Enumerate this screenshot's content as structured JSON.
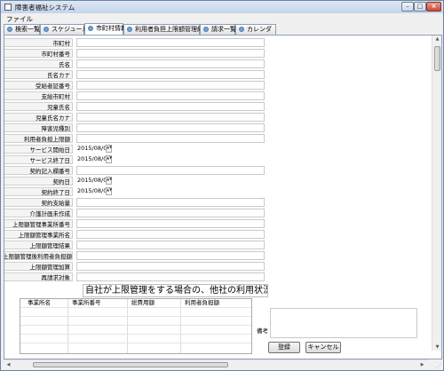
{
  "window": {
    "title": "障害者福祉システム"
  },
  "menu": {
    "file": "ファイル"
  },
  "tabs": [
    {
      "label": "検索一覧"
    },
    {
      "label": "スケジュール"
    },
    {
      "label": "市町村情報"
    },
    {
      "label": "利用者負担上限額管理結果票"
    },
    {
      "label": "請求一覧"
    },
    {
      "label": "カレンダ"
    }
  ],
  "active_tab": "市町村情報",
  "form": {
    "fields": [
      {
        "label": "市町村"
      },
      {
        "label": "市町村番号"
      },
      {
        "label": "氏名"
      },
      {
        "label": "氏名カナ"
      },
      {
        "label": "受給者証番号"
      },
      {
        "label": "支給市町村"
      },
      {
        "label": "児童氏名"
      },
      {
        "label": "児童氏名カナ"
      },
      {
        "label": "障害児種別"
      },
      {
        "label": "利用者負担上限額"
      },
      {
        "label": "サービス開始日",
        "value": "2015/08/08"
      },
      {
        "label": "サービス終了日",
        "value": "2015/08/08"
      },
      {
        "label": "契約記入欄番号"
      },
      {
        "label": "契約日",
        "value": "2015/08/08"
      },
      {
        "label": "契約終了日",
        "value": "2015/08/08"
      },
      {
        "label": "契約支給量"
      },
      {
        "label": "介護計画未作成"
      },
      {
        "label": "上限額管理事業所番号"
      },
      {
        "label": "上限額管理事業所名"
      },
      {
        "label": "上限額管理結果"
      },
      {
        "label": "上限額管理後利用者負担額"
      },
      {
        "label": "上限額管理加算"
      },
      {
        "label": "再請求対象"
      }
    ]
  },
  "notice": "自社が上限管理をする場合の、他社の利用状況",
  "grid": {
    "columns": [
      "事業所名",
      "事業所番号",
      "総費用額",
      "利用者負担額"
    ]
  },
  "remarks": {
    "label": "備考",
    "value": ""
  },
  "buttons": {
    "register": "登録",
    "cancel": "キャンセル"
  },
  "icons": {
    "app": "app-icon",
    "tab": "tab-globe-icon",
    "minimize": "minimize-icon",
    "maximize": "maximize-icon",
    "close": "close-icon"
  }
}
